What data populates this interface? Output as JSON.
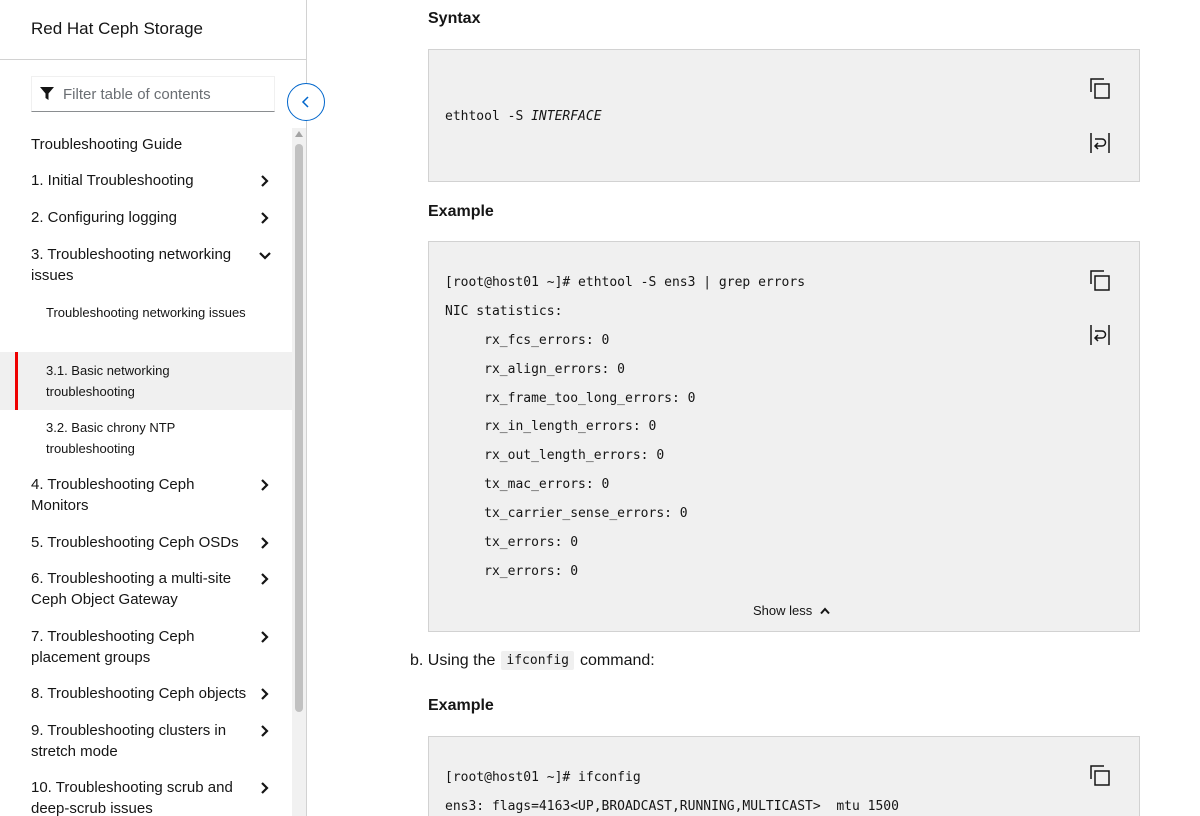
{
  "sidebar": {
    "product_title": "Red Hat Ceph Storage",
    "filter_placeholder": "Filter table of contents",
    "items": [
      {
        "label": "Troubleshooting Guide",
        "chevron": "none"
      },
      {
        "label": "1. Initial Troubleshooting",
        "chevron": "right"
      },
      {
        "label": "2. Configuring logging",
        "chevron": "right"
      },
      {
        "label": "3. Troubleshooting networking issues",
        "chevron": "down"
      },
      {
        "label": "4. Troubleshooting Ceph Monitors",
        "chevron": "right"
      },
      {
        "label": "5. Troubleshooting Ceph OSDs",
        "chevron": "right"
      },
      {
        "label": "6. Troubleshooting a multi-site Ceph Object Gateway",
        "chevron": "right"
      },
      {
        "label": "7. Troubleshooting Ceph placement groups",
        "chevron": "right"
      },
      {
        "label": "8. Troubleshooting Ceph objects",
        "chevron": "right"
      },
      {
        "label": "9. Troubleshooting clusters in stretch mode",
        "chevron": "right"
      },
      {
        "label": "10. Troubleshooting scrub and deep-scrub issues",
        "chevron": "right"
      }
    ],
    "subitems": [
      {
        "label": "Troubleshooting networking issues",
        "active": false
      },
      {
        "label": "3.1. Basic networking troubleshooting",
        "active": true
      },
      {
        "label": "3.2. Basic chrony NTP troubleshooting",
        "active": false
      }
    ]
  },
  "content": {
    "syntax_heading": "Syntax",
    "syntax_cmd_prefix": "ethtool -S ",
    "syntax_cmd_var": "INTERFACE",
    "example_heading_1": "Example",
    "example1_lines": [
      "[root@host01 ~]# ethtool -S ens3 | grep errors",
      "NIC statistics:",
      "     rx_fcs_errors: 0",
      "     rx_align_errors: 0",
      "     rx_frame_too_long_errors: 0",
      "     rx_in_length_errors: 0",
      "     rx_out_length_errors: 0",
      "     tx_mac_errors: 0",
      "     tx_carrier_sense_errors: 0",
      "     tx_errors: 0",
      "     rx_errors: 0"
    ],
    "show_less_label": "Show less",
    "step_b_prefix": "b. Using the",
    "step_b_code": "ifconfig",
    "step_b_suffix": "command:",
    "example_heading_2": "Example",
    "example2_lines": [
      "[root@host01 ~]# ifconfig",
      "ens3: flags=4163<UP,BROADCAST,RUNNING,MULTICAST>  mtu 1500"
    ]
  },
  "colors": {
    "accent": "#0066cc",
    "active_marker": "#ee0000",
    "code_bg": "#f0f0f0"
  }
}
